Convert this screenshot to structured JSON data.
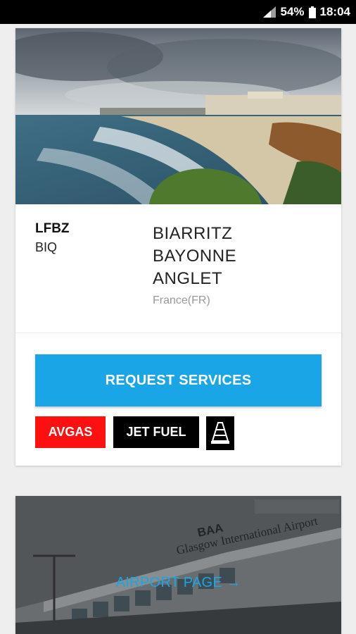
{
  "status_bar": {
    "battery": "54%",
    "time": "18:04"
  },
  "airport": {
    "icao": "LFBZ",
    "iata": "BIQ",
    "city_lines": [
      "BIARRITZ",
      "BAYONNE",
      "ANGLET"
    ],
    "country": "France(FR)"
  },
  "actions": {
    "request_services": "REQUEST SERVICES"
  },
  "fuel_badges": {
    "avgas": "AVGAS",
    "jet_fuel": "JET FUEL"
  },
  "second_card": {
    "sign_text": "Glasgow International Airport",
    "sign_logo": "BAA",
    "link_label": "AIRPORT PAGE",
    "link_arrow": "→"
  },
  "colors": {
    "accent": "#1aa6e6",
    "avgas": "#ff1010",
    "jet_fuel": "#000000"
  },
  "icons": [
    "signal-icon",
    "battery-icon",
    "traffic-cone-icon",
    "arrow-right-icon"
  ]
}
